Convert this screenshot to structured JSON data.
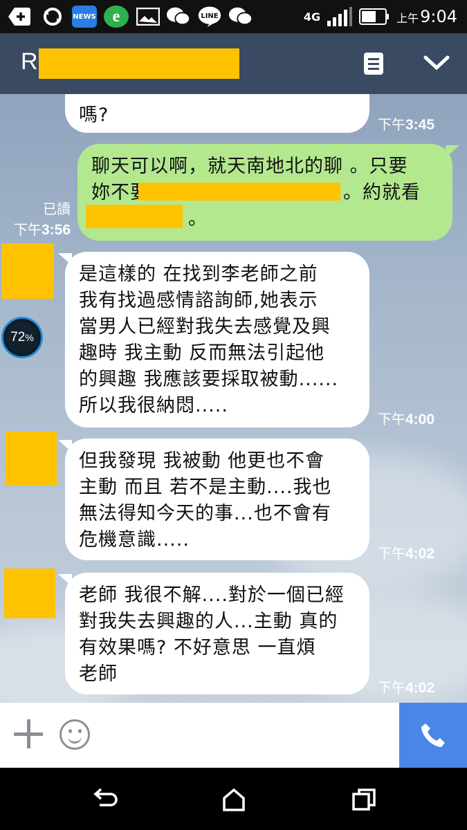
{
  "status_bar": {
    "news_label": "NEWS",
    "line_label": "LINE",
    "network": "4G",
    "time_prefix": "上午",
    "time": "9:04"
  },
  "header": {
    "title_initial": "R"
  },
  "messages": [
    {
      "side": "in",
      "lines": [
        "嗎?"
      ],
      "time_prefix": "下午",
      "time": "3:45"
    },
    {
      "side": "out",
      "lines": [
        "聊天可以啊，就天南地北的聊 。只要",
        "妳不要",
        "。"
      ],
      "inline_after": "。約就看",
      "read": "已讀",
      "time_prefix": "下午",
      "time": "3:56"
    },
    {
      "side": "in",
      "lines": [
        "是這樣的  在找到李老師之前",
        "我有找過感情諮詢師,她表示",
        "當男人已經對我失去感覺及興",
        "趣時  我主動 反而無法引起他",
        "的興趣  我應該要採取被動......",
        "所以我很納悶....."
      ],
      "time_prefix": "下午",
      "time": "4:00"
    },
    {
      "side": "in",
      "lines": [
        "但我發現  我被動  他更也不會",
        "主動 而且 若不是主動....我也",
        "無法得知今天的事...也不會有",
        "危機意識....."
      ],
      "time_prefix": "下午",
      "time": "4:02"
    },
    {
      "side": "in",
      "lines": [
        "老師 我很不解....對於一個已經",
        "對我失去興趣的人...主動 真的",
        "有效果嗎?  不好意思   一直煩",
        "老師"
      ],
      "time_prefix": "下午",
      "time": "4:02"
    }
  ],
  "overlay": {
    "percent": "72",
    "unit": "%"
  },
  "colors": {
    "header": "#3a4a63",
    "outgoing_bubble": "#b3e88f",
    "redaction": "#ffc200",
    "call_button": "#4a86e8"
  },
  "icons": [
    "add-icon",
    "sync-icon",
    "news-app-icon",
    "browser-icon",
    "image-icon",
    "wechat-icon",
    "line-icon",
    "wechat-icon",
    "signal-icon",
    "battery-icon",
    "notes-icon",
    "chevron-down-icon",
    "plus-icon",
    "emoji-icon",
    "phone-icon",
    "back-icon",
    "home-icon",
    "recents-icon"
  ]
}
